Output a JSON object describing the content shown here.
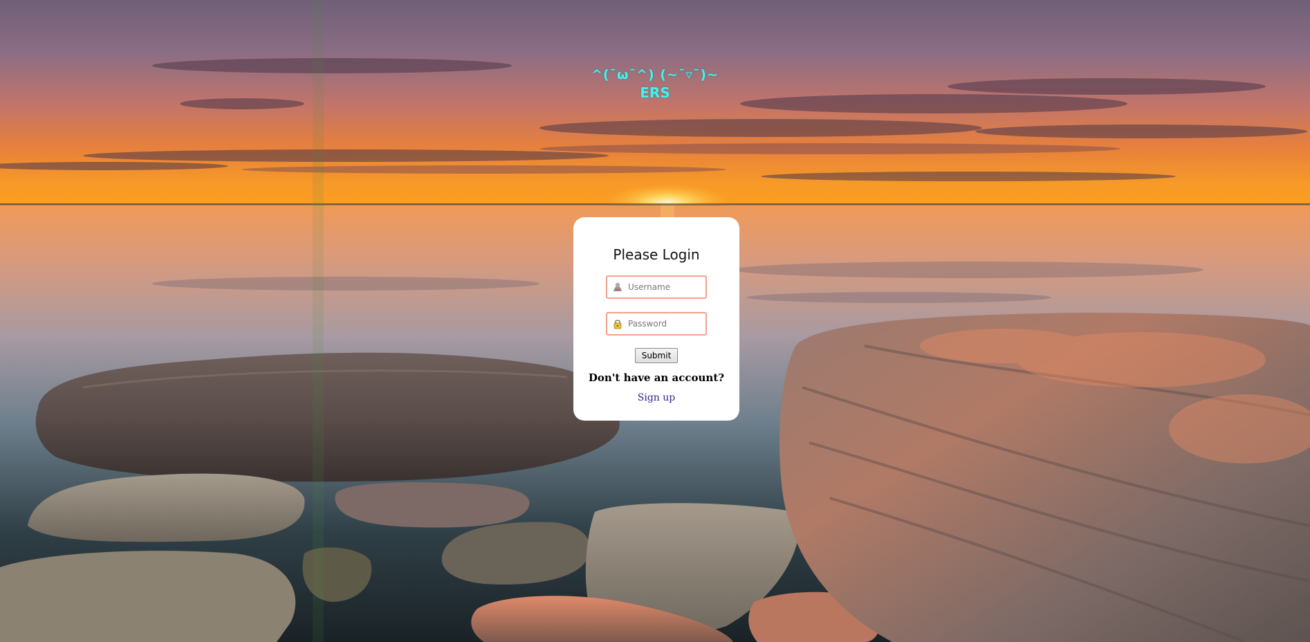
{
  "brand": {
    "kaomoji": "^(¯ω¯^) (~¯▿¯)~",
    "title": "ERS",
    "color": "#3ff4f0"
  },
  "login": {
    "heading": "Please Login",
    "username_placeholder": "Username",
    "password_placeholder": "Password",
    "submit_label": "Submit",
    "no_account_text": "Don't have an account?",
    "signup_label": "Sign up"
  },
  "icons": {
    "username": "user-icon",
    "password": "padlock-icon"
  },
  "theme": {
    "card_background": "#ffffff",
    "field_border": "#f3a08d",
    "link_color": "#3a1b8a"
  }
}
